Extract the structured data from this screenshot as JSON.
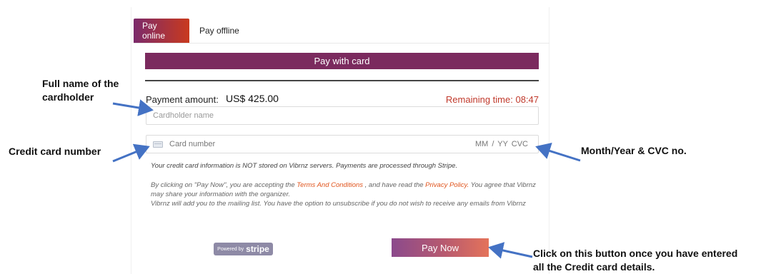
{
  "tabs": {
    "online": "Pay online",
    "offline": "Pay offline"
  },
  "header": {
    "title": "Pay with card"
  },
  "payment": {
    "amount_label": "Payment amount:",
    "amount_value": "US$ 425.00",
    "remaining": "Remaining time: 08:47"
  },
  "form": {
    "cardholder_placeholder": "Cardholder name",
    "card_number_placeholder": "Card number",
    "expiry_cvc": "MM / YY  CVC"
  },
  "notice": "Your credit card information is NOT stored on Vibrnz servers. Payments are processed through Stripe.",
  "terms": {
    "part1": "By clicking on \"Pay Now\", you are accepting the ",
    "terms_link": "Terms And Conditions",
    "part2": " , and have read the ",
    "privacy_link": "Privacy Policy.",
    "part3": " You agree that Vibrnz may share your information with the organizer.",
    "part4": "Vibrnz will add you to the mailing list. You have the option to unsubscribe if you do not wish to receive any emails from Vibrnz"
  },
  "stripe": {
    "powered_by": "Powered by",
    "brand": "stripe"
  },
  "pay_button": "Pay Now",
  "annotations": {
    "full_name": "Full name of the cardholder",
    "credit_card_number": "Credit card number",
    "month_year_cvc": "Month/Year & CVC no.",
    "click_button": "Click on this button once you have entered all the Credit card details."
  },
  "colors": {
    "tab_gradient_start": "#7b2a6b",
    "tab_gradient_end": "#c93a1e",
    "header_bar": "#7b2a5e",
    "remaining_time": "#c0392b",
    "link": "#e0541c",
    "arrow": "#4472c4"
  },
  "icons": {
    "card_field": "credit-card-icon"
  }
}
